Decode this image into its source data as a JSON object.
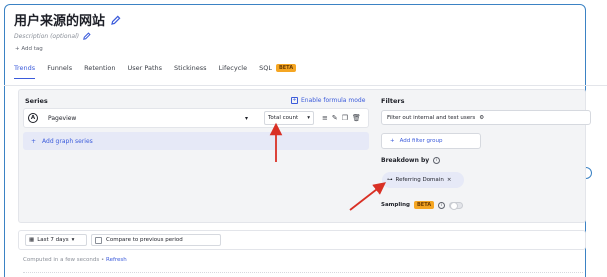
{
  "header": {
    "title": "用户来源的网站",
    "description_placeholder": "Description (optional)",
    "add_tag": "+ Add tag"
  },
  "tabs": [
    {
      "label": "Trends",
      "active": true
    },
    {
      "label": "Funnels"
    },
    {
      "label": "Retention"
    },
    {
      "label": "User Paths"
    },
    {
      "label": "Stickiness"
    },
    {
      "label": "Lifecycle"
    },
    {
      "label": "SQL",
      "badge": "BETA"
    }
  ],
  "series": {
    "label": "Series",
    "enable_formula": "Enable formula mode",
    "items": [
      {
        "letter": "A",
        "event": "Pageview",
        "aggregation": "Total count"
      }
    ],
    "add_series": "Add graph series"
  },
  "filters": {
    "label": "Filters",
    "filter_internal": "Filter out internal and test users",
    "add_filter_group": "Add filter group"
  },
  "breakdown": {
    "label": "Breakdown by",
    "chip": "Referring Domain",
    "chip_close": "×"
  },
  "sampling": {
    "label": "Sampling",
    "badge": "BETA",
    "enabled": false
  },
  "controls": {
    "date_range": "Last 7 days",
    "compare": "Compare to previous period"
  },
  "status": {
    "computed": "Computed in a few seconds •",
    "refresh": "Refresh"
  },
  "colors": {
    "accent": "#3b5bdb",
    "annotation_arrow": "#d93025",
    "beta_badge": "#f5a623"
  }
}
